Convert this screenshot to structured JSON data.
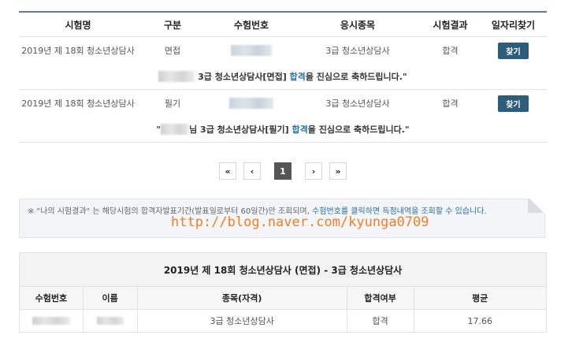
{
  "results_table": {
    "headers": [
      "시험명",
      "구분",
      "수험번호",
      "응시종목",
      "시험결과",
      "일자리찾기"
    ],
    "rows": [
      {
        "exam": "2019년 제 18회 청소년상담사",
        "type": "면접",
        "field": "3급 청소년상담사",
        "result": "합격",
        "button": "찾기",
        "congrats": {
          "mid": " 3급 청소년상담사[면접] ",
          "hl": "합격",
          "end": "을 진심으로 축하드립니다.\""
        }
      },
      {
        "exam": "2019년 제 18회 청소년상담사",
        "type": "필기",
        "field": "3급 청소년상담사",
        "result": "합격",
        "button": "찾기",
        "congrats": {
          "pre": "\"",
          "mid": "님 3급 청소년상담사[필기] ",
          "hl": "합격",
          "end": "을 진심으로 축하드립니다.\""
        }
      }
    ]
  },
  "pagination": {
    "first": "«",
    "prev": "‹",
    "current": "1",
    "next": "›",
    "last": "»"
  },
  "notice": {
    "part1": "※ \"나의 시험결과\" 는 해당시험의 합격자발표기간(발표일로부터 60일간)만 조회되며, ",
    "part2": "수험번호를 클릭하면 득점내역을 조회할 수 있습니다."
  },
  "watermark": "http://blog.naver.com/kyunga0709",
  "summary": {
    "title": "2019년 제 18회 청소년상담사 (면접) - 3급 청소년상담사",
    "headers": [
      "수험번호",
      "이름",
      "종목(자격)",
      "합격여부",
      "평균"
    ],
    "row": {
      "field": "3급 청소년상담사",
      "pass": "합격",
      "avg": "17.66"
    }
  }
}
